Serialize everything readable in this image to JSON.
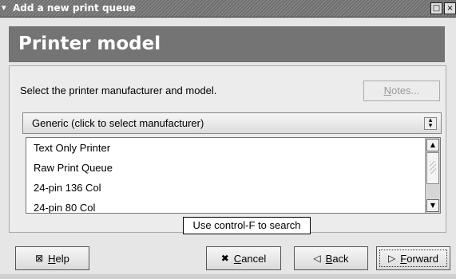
{
  "window": {
    "title": "Add a new print queue",
    "menu_icon": "chevron-down-icon",
    "maximize_icon": "□",
    "close_icon": "×"
  },
  "header": {
    "title": "Printer model"
  },
  "content": {
    "instruction": "Select the printer manufacturer and model.",
    "notes_button": {
      "mnemonic": "N",
      "rest": "otes..."
    },
    "manufacturer_combo": {
      "value": "Generic (click to select manufacturer)"
    },
    "model_list": {
      "items": [
        "Text Only Printer",
        "Raw Print Queue",
        "24-pin 136 Col",
        "24-pin 80 Col"
      ]
    },
    "tooltip": "Use control-F to search"
  },
  "buttons": {
    "help": {
      "mnemonic": "H",
      "rest": "elp",
      "icon": "help-icon"
    },
    "cancel": {
      "mnemonic": "C",
      "rest": "ancel",
      "icon": "cancel-icon"
    },
    "back": {
      "mnemonic": "B",
      "rest": "ack",
      "icon": "back-arrow-icon"
    },
    "forward": {
      "mnemonic": "F",
      "rest": "orward",
      "icon": "forward-arrow-icon"
    }
  }
}
